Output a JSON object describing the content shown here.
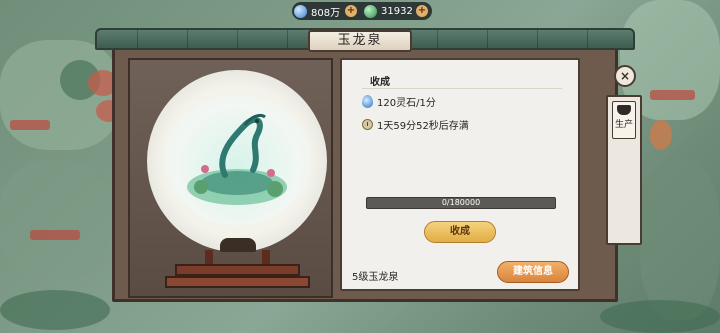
{
  "currency": {
    "spirit_water": "808万",
    "jade": "31932",
    "add_label": "+"
  },
  "building": {
    "title": "玉龙泉",
    "level_label": "5级玉龙泉",
    "info_button": "建筑信息"
  },
  "harvest": {
    "header": "收成",
    "rate": "120灵石/1分",
    "time_to_full": "1天59分52秒后存满",
    "progress_text": "0/180000",
    "progress_fraction": 0,
    "button": "收成"
  },
  "side": {
    "close_label": "×",
    "production_tab": "生产"
  },
  "colors": {
    "accent_gold": "#e2ad45",
    "accent_orange": "#d9843c",
    "frame_brown": "#6e5b4d",
    "roof_green": "#4f6f62"
  },
  "icons": [
    "spirit-water-icon",
    "jade-icon",
    "drop-icon",
    "clock-icon",
    "pot-icon",
    "close-icon"
  ]
}
